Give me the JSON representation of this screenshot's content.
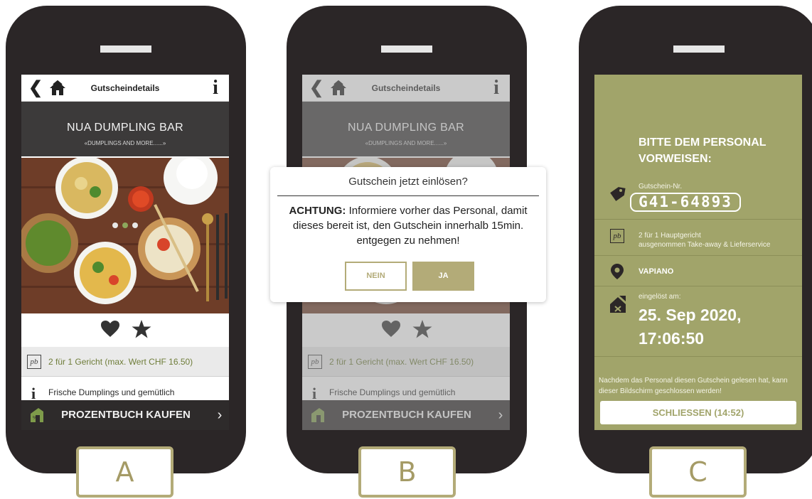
{
  "colors": {
    "accent": "#b3ab78",
    "green_screen": "#a1a46a",
    "phone": "#2b2627",
    "offer_text": "#6f7d3a"
  },
  "panels": {
    "a": {
      "letter": "A"
    },
    "b": {
      "letter": "B"
    },
    "c": {
      "letter": "C"
    }
  },
  "topbar": {
    "back_icon": "back-chevron-icon",
    "home_icon": "home-icon",
    "title": "Gutscheindetails",
    "info_icon": "info-icon",
    "info_glyph": "i"
  },
  "venue": {
    "name": "NUA DUMPLING BAR",
    "subtitle": "«DUMPLINGS AND MORE......»"
  },
  "photo": {
    "dots": 3,
    "active_dot": 1
  },
  "rating": {
    "heart_icon": "heart-icon",
    "star_icon": "star-icon"
  },
  "offer": {
    "icon_text": "pb",
    "text": "2 für 1 Gericht (max. Wert CHF 16.50)"
  },
  "description": {
    "icon_glyph": "i",
    "text": "Frische Dumplings und gemütlich"
  },
  "buybar": {
    "icon": "house-percent-icon",
    "label": "PROZENTBUCH KAUFEN",
    "chevron": "›"
  },
  "dialog": {
    "title": "Gutschein jetzt einlösen?",
    "warning_prefix": "ACHTUNG:",
    "warning_text": "Informiere vorher das Personal, damit dieses bereit ist, den Gutschein innerhalb 15min. entgegen zu nehmen!",
    "no_label": "NEIN",
    "yes_label": "JA"
  },
  "confirmation": {
    "heading": "BITTE DEM PERSONAL VORWEISEN:",
    "code_label": "Gutschein-Nr.",
    "code": "G41-64893",
    "deal_icon_text": "pb",
    "deal_line1": "2 für 1 Hauptgericht",
    "deal_line2": "ausgenommen Take-away & Lieferservice",
    "location": "VAPIANO",
    "redeemed_label": "eingelöst am:",
    "redeemed_date": "25. Sep 2020,",
    "redeemed_time": "17:06:50",
    "note": "Nachdem das Personal diesen Gutschein gelesen hat, kann dieser Bildschirm geschlossen werden!",
    "close_label": "SCHLIESSEN (14:52)"
  }
}
